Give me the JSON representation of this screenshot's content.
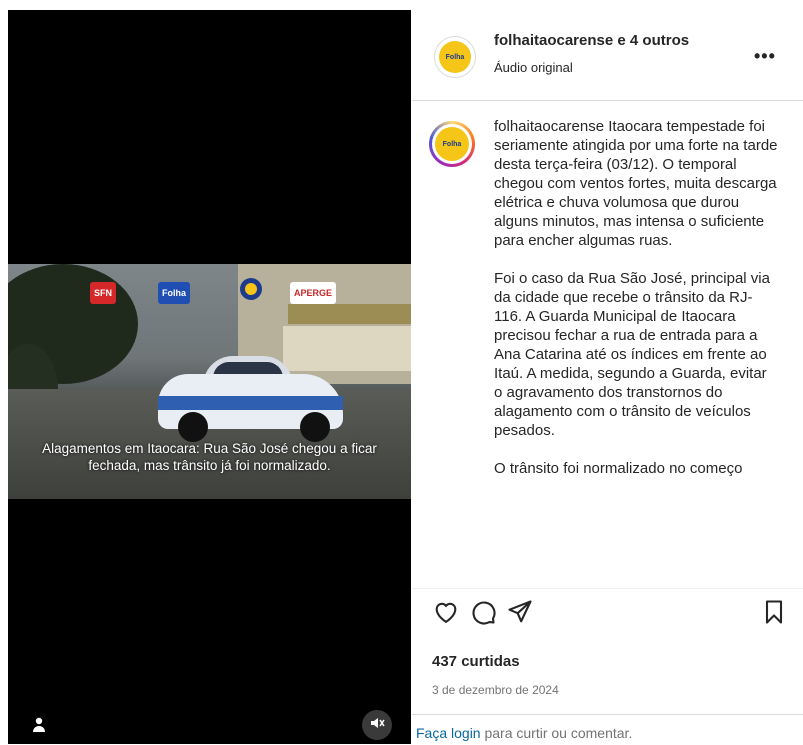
{
  "video": {
    "caption": "Alagamentos em Itaocara: Rua São José chegou a ficar fechada, mas trânsito já foi normalizado.",
    "logos": [
      "SFN",
      "Folha",
      "APERGE"
    ],
    "user_icon": "person-icon",
    "mute_icon": "speaker-muted-icon"
  },
  "header": {
    "username": "folhaitaocarense",
    "coauthors": "e 4 outros",
    "audio": "Áudio original",
    "more_icon": "more-horizontal-icon"
  },
  "caption": {
    "username": "folhaitaocarense",
    "paragraph1": " Itaocara tempestade foi seriamente atingida por uma forte na tarde desta terça-feira (03/12). O temporal chegou com ventos fortes, muita descarga elétrica e chuva volumosa que durou alguns minutos, mas intensa o suficiente para encher algumas ruas.",
    "paragraph2": "Foi o caso da Rua São José, principal via da cidade que recebe o trânsito da RJ-116. A Guarda Municipal de Itaocara precisou fechar a rua de entrada para a Ana Catarina até os índices em frente ao Itaú. A medida, segundo a Guarda, evitar o agravamento dos transtornos do alagamento com o trânsito de veículos pesados.",
    "paragraph3": "O trânsito foi normalizado no começo"
  },
  "actions": {
    "like_icon": "heart-icon",
    "comment_icon": "comment-icon",
    "share_icon": "send-icon",
    "save_icon": "bookmark-icon"
  },
  "likes": "437 curtidas",
  "date": "3 de dezembro de 2024",
  "login": {
    "link": "Faça login",
    "rest": " para curtir ou comentar."
  },
  "colors": {
    "link": "#0a66a0",
    "avatar_yellow": "#f5c518",
    "story_ring": "#d6249f"
  }
}
